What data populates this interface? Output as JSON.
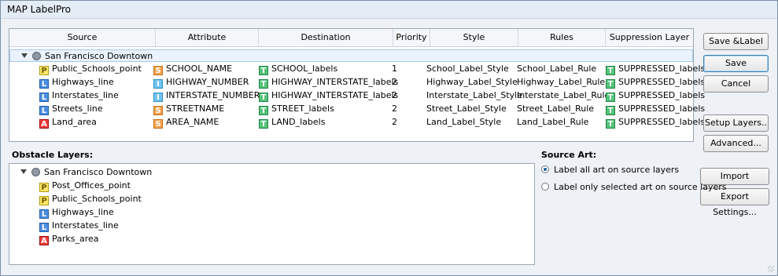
{
  "window": {
    "title": "MAP LabelPro"
  },
  "grid": {
    "columns": [
      "Source",
      "Attribute",
      "Destination",
      "Priority",
      "Style",
      "Rules",
      "Suppression Layer"
    ],
    "root": "San Francisco Downtown",
    "rows": [
      {
        "source_icon": "P",
        "source": "Public_Schools_point",
        "attr_icon": "S",
        "attribute": "SCHOOL_NAME",
        "dest_icon": "T",
        "destination": "SCHOOL_labels",
        "priority": "1",
        "style": "School_Label_Style",
        "rules": "School_Label_Rule",
        "supp_icon": "T",
        "suppression": "SUPPRESSED_labels"
      },
      {
        "source_icon": "L",
        "source": "Highways_line",
        "attr_icon": "I",
        "attribute": "HIGHWAY_NUMBER",
        "dest_icon": "T",
        "destination": "HIGHWAY_INTERSTATE_labels",
        "priority": "2",
        "style": "Highway_Label_Style",
        "rules": "Highway_Label_Rule",
        "supp_icon": "T",
        "suppression": "SUPPRESSED_labels"
      },
      {
        "source_icon": "L",
        "source": "Interstates_line",
        "attr_icon": "I",
        "attribute": "INTERSTATE_NUMBER",
        "dest_icon": "T",
        "destination": "HIGHWAY_INTERSTATE_labels",
        "priority": "2",
        "style": "Interstate_Label_Style",
        "rules": "Interstate_Label_Rule",
        "supp_icon": "T",
        "suppression": "SUPPRESSED_labels"
      },
      {
        "source_icon": "L",
        "source": "Streets_line",
        "attr_icon": "S",
        "attribute": "STREETNAME",
        "dest_icon": "T",
        "destination": "STREET_labels",
        "priority": "2",
        "style": "Street_Label_Style",
        "rules": "Street_Label_Rule",
        "supp_icon": "T",
        "suppression": "SUPPRESSED_labels"
      },
      {
        "source_icon": "A",
        "source": "Land_area",
        "attr_icon": "S",
        "attribute": "AREA_NAME",
        "dest_icon": "T",
        "destination": "LAND_labels",
        "priority": "2",
        "style": "Land_Label_Style",
        "rules": "Land_Label_Rule",
        "supp_icon": "T",
        "suppression": "SUPPRESSED_labels"
      }
    ]
  },
  "buttons": {
    "save_label": "Save &Label",
    "save": "Save",
    "cancel": "Cancel",
    "setup_layers": "Setup Layers..",
    "advanced": "Advanced...",
    "import_settings": "Import Settings...",
    "export_settings": "Export Settings..."
  },
  "obstacle": {
    "title": "Obstacle Layers:",
    "root": "San Francisco Downtown",
    "items": [
      {
        "icon": "P",
        "label": "Post_Offices_point"
      },
      {
        "icon": "P",
        "label": "Public_Schools_point"
      },
      {
        "icon": "L",
        "label": "Highways_line"
      },
      {
        "icon": "L",
        "label": "Interstates_line"
      },
      {
        "icon": "A",
        "label": "Parks_area"
      }
    ]
  },
  "source_art": {
    "title": "Source Art:",
    "option_all": "Label all art on source layers",
    "option_selected": "Label only selected art on source layers",
    "selected": "all"
  },
  "colors": {
    "point": "#ffe76b",
    "line": "#4b8ee0",
    "area": "#ef3c3c",
    "string_attr": "#f6a24d",
    "int_attr": "#6fc4ef",
    "text_layer": "#55c27a"
  }
}
